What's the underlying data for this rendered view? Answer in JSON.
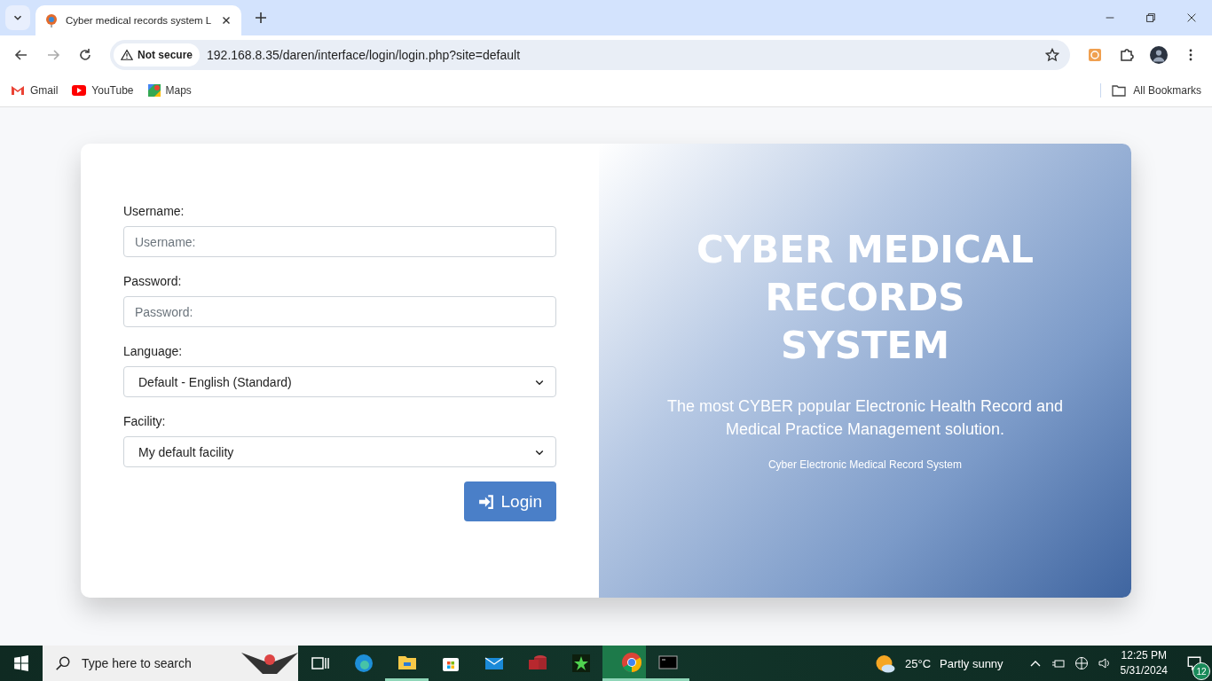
{
  "browser": {
    "tab": {
      "title": "Cyber medical records system L"
    },
    "security": "Not secure",
    "url": "192.168.8.35/daren/interface/login/login.php?site=default",
    "bookmarks": [
      {
        "kind": "gmail",
        "label": "Gmail"
      },
      {
        "kind": "youtube",
        "label": "YouTube"
      },
      {
        "kind": "maps",
        "label": "Maps"
      }
    ],
    "all_bookmarks": "All Bookmarks"
  },
  "login": {
    "fields": [
      {
        "kind": "input",
        "label": "Username:",
        "placeholder": "Username:"
      },
      {
        "kind": "input",
        "label": "Password:",
        "placeholder": "Password:"
      },
      {
        "kind": "select",
        "label": "Language:",
        "value": "Default - English (Standard)"
      },
      {
        "kind": "select",
        "label": "Facility:",
        "value": "My default facility"
      }
    ],
    "button": "Login"
  },
  "hero": {
    "title": "CYBER MEDICAL RECORDS SYSTEM",
    "subtitle": "The most CYBER popular Electronic Health Record and Medical Practice Management solution.",
    "caption": "Cyber Electronic Medical Record System"
  },
  "taskbar": {
    "search_placeholder": "Type here to search",
    "apps": [
      {
        "kind": "taskview",
        "running": false,
        "selected": false
      },
      {
        "kind": "edge",
        "running": false,
        "selected": false
      },
      {
        "kind": "explorer",
        "running": true,
        "selected": false
      },
      {
        "kind": "store",
        "running": false,
        "selected": false
      },
      {
        "kind": "mail",
        "running": false,
        "selected": false
      },
      {
        "kind": "access",
        "running": false,
        "selected": false
      },
      {
        "kind": "game",
        "running": false,
        "selected": false
      },
      {
        "kind": "chrome",
        "running": true,
        "selected": true
      },
      {
        "kind": "terminal",
        "running": true,
        "selected": false
      }
    ],
    "weather": {
      "temp": "25°C",
      "condition": "Partly sunny"
    },
    "time": "12:25 PM",
    "date": "5/31/2024",
    "notifications": "12"
  }
}
